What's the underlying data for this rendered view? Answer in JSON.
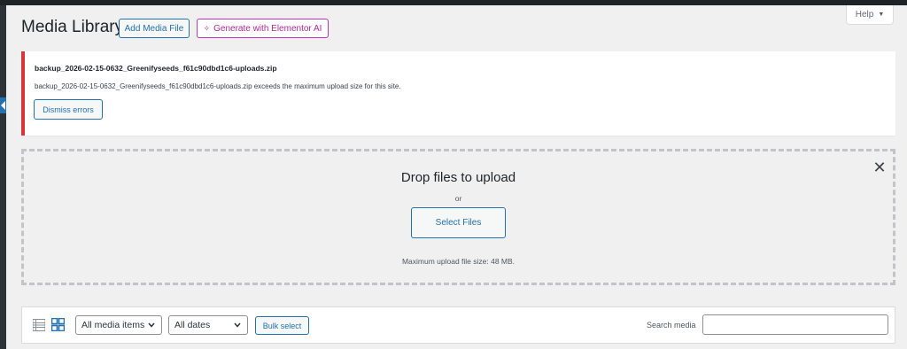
{
  "header": {
    "title": "Media Library",
    "add_button": "Add Media File",
    "ai_button": "Generate with Elementor AI",
    "help_label": "Help"
  },
  "notice": {
    "filename": "backup_2026-02-15-0632_Greenifyseeds_f61c90dbd1c6-uploads.zip",
    "message": "backup_2026-02-15-0632_Greenifyseeds_f61c90dbd1c6-uploads.zip exceeds the maximum upload size for this site.",
    "dismiss_label": "Dismiss errors"
  },
  "uploader": {
    "title": "Drop files to upload",
    "or_text": "or",
    "select_button": "Select Files",
    "max_size_text": "Maximum upload file size: 48 MB."
  },
  "toolbar": {
    "media_filter": "All media items",
    "date_filter": "All dates",
    "bulk_select": "Bulk select",
    "search_label": "Search media",
    "search_value": ""
  },
  "colors": {
    "accent": "#2271b1",
    "error": "#d63638",
    "elementor": "#b5279b",
    "background": "#f0f0f1"
  }
}
